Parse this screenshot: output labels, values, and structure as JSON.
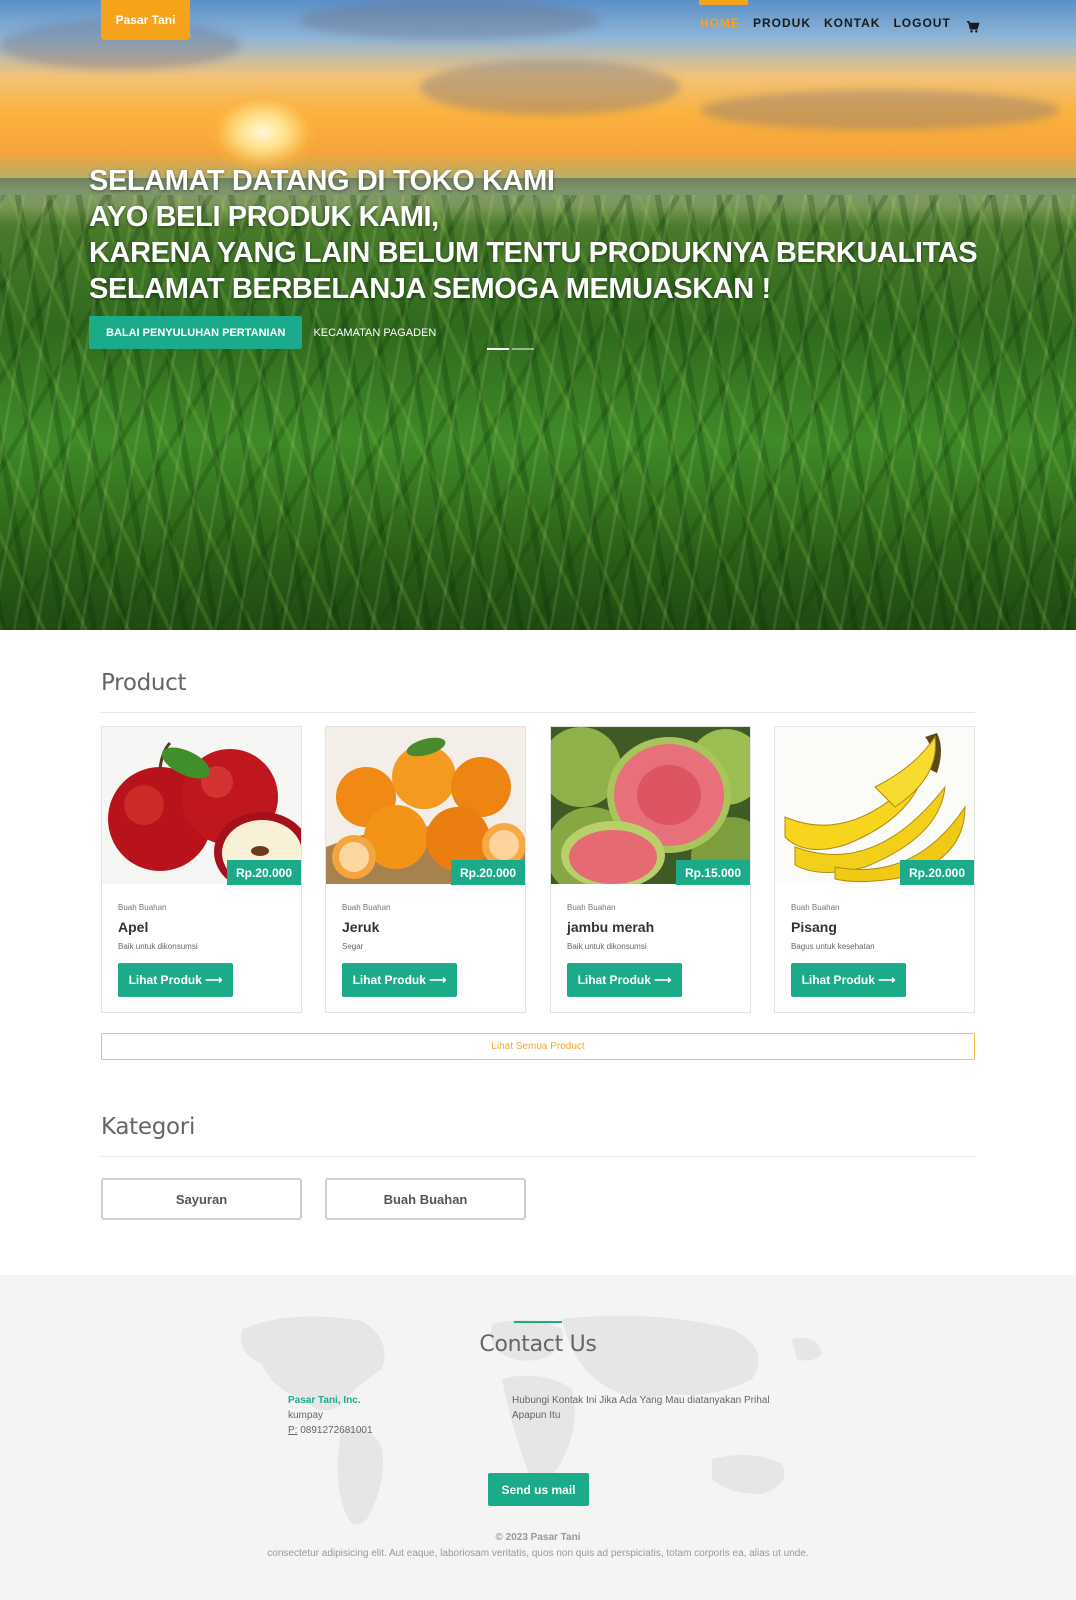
{
  "brand": {
    "name": "Pasar Tani"
  },
  "nav": {
    "items": [
      {
        "label": "HOME",
        "active": true
      },
      {
        "label": "PRODUK",
        "active": false
      },
      {
        "label": "KONTAK",
        "active": false
      },
      {
        "label": "LOGOUT",
        "active": false
      }
    ],
    "cart_icon": "shopping-cart"
  },
  "hero": {
    "lines": [
      "SELAMAT DATANG DI TOKO KAMI",
      "AYO BELI PRODUK KAMI,",
      "KARENA YANG LAIN BELUM TENTU PRODUKNYA BERKUALITAS",
      "SELAMAT BERBELANJA SEMOGA MEMUASKAN !"
    ],
    "button_label": "BALAI PENYULUHAN PERTANIAN",
    "link_label": "KECAMATAN PAGADEN",
    "slides": 2,
    "active_slide": 1
  },
  "products": {
    "title": "Product",
    "items": [
      {
        "category": "Buah Buahan",
        "name": "Apel",
        "desc": "Baik untuk dikonsumsi",
        "price": "Rp.20.000",
        "button": "Lihat Produk ⟶",
        "image": "apple"
      },
      {
        "category": "Buah Buahan",
        "name": "Jeruk",
        "desc": "Segar",
        "price": "Rp.20.000",
        "button": "Lihat Produk ⟶",
        "image": "orange"
      },
      {
        "category": "Buah Buahan",
        "name": "jambu merah",
        "desc": "Baik untuk dikonsumsi",
        "price": "Rp.15.000",
        "button": "Lihat Produk ⟶",
        "image": "guava"
      },
      {
        "category": "Buah Buahan",
        "name": "Pisang",
        "desc": "Bagus untuk kesehatan",
        "price": "Rp.20.000",
        "button": "Lihat Produk ⟶",
        "image": "banana"
      }
    ],
    "all_button": "Lihat Semua Product"
  },
  "categories": {
    "title": "Kategori",
    "items": [
      "Sayuran",
      "Buah Buahan"
    ]
  },
  "contact": {
    "title": "Contact Us",
    "company": "Pasar Tani, Inc.",
    "address": "kumpay",
    "phone_label": "P:",
    "phone": "0891272681001",
    "message": "Hubungi Kontak Ini Jika Ada Yang Mau diatanyakan Prihal Apapun Itu",
    "mail_button": "Send us mail"
  },
  "footer": {
    "copyright": "© 2023 Pasar Tani",
    "text": "consectetur adipisicing elit. Aut eaque, laboriosam veritatis, quos non quis ad perspiciatis, totam corporis ea, alias ut unde."
  },
  "colors": {
    "accent_orange": "#f7a21b",
    "accent_green": "#1bab8a"
  }
}
